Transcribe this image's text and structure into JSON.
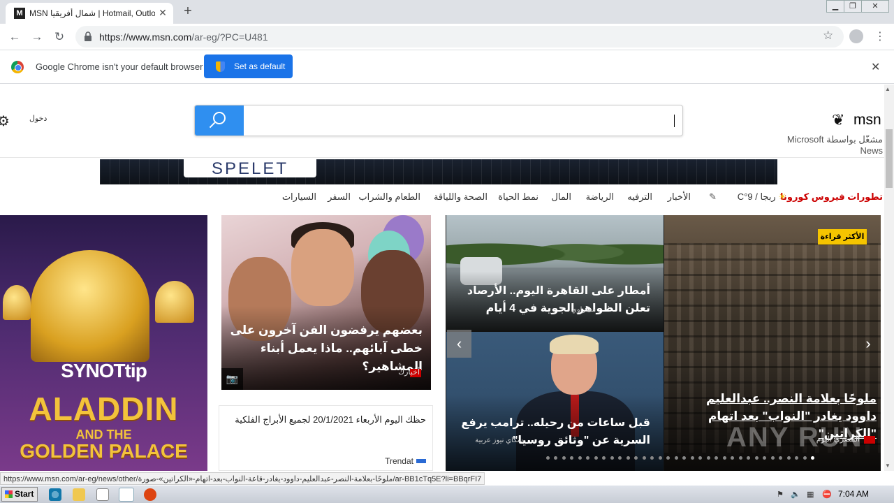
{
  "browser": {
    "tab_title": "MSN شمال أفريقيا | Hotmail, Outlook",
    "tab_favicon": "M",
    "url_host": "https://www.msn.com",
    "url_path": "/ar-eg/?PC=U481",
    "new_tab_glyph": "+",
    "close_glyph": "✕"
  },
  "infobar": {
    "message": "Google Chrome isn't your default browser",
    "button_label": "Set as default"
  },
  "msn": {
    "signin_label": "دخول",
    "logo_text": "msn",
    "subtitle": "مشغّل بواسطة Microsoft News",
    "banner_text": "SPELET"
  },
  "nav": {
    "corona": "تطورات فيروس كورونا",
    "weather": "ربجا / 9°C",
    "items": [
      "الأخبار",
      "الترفيه",
      "الرياضة",
      "المال",
      "نمط الحياة",
      "الصحة واللياقة",
      "الطعام والشراب",
      "السفر",
      "السيارات"
    ]
  },
  "ad": {
    "brand": "SYNOTtip",
    "line1": "ALADDIN",
    "line2": "AND THE",
    "line3": "GOLDEN PALACE"
  },
  "cards": {
    "celeb": {
      "title": "بعضهم يرفضون الفن آخرون على خطى آبائهم.. ماذا يعمل أبناء المشاهير؟",
      "source": "أخبارك"
    },
    "horoscope": {
      "title": "حظك اليوم الأربعاء 20/1/2021 لجميع الأبراج الفلكية",
      "source": "Trendat"
    }
  },
  "slider": {
    "hero": {
      "badge": "الأكثر قراءة",
      "title": "ملوحًا بعلامة النصر.. عبدالعليم داوود يغادر \"النواب\" بعد اتهام \"الكراتين\"",
      "source": "المصري اليوم"
    },
    "rain": {
      "title": "أمطار على القاهرة اليوم.. الأرصاد تعلن الظواهر الجوية في 4 أيام",
      "source": "مصراوي"
    },
    "trump": {
      "title": "قبل ساعات من رحيله.. ترامب يرفع السرية عن \"وثائق روسيا\"",
      "source": "سكاي نيوز عربية"
    },
    "total_dots": 34,
    "active_dot": 0
  },
  "status_url": "https://www.msn.com/ar-eg/news/other/ملوحًا-بعلامة-النصر-عبدالعليم-داوود-يغادر-قاعة-النواب-بعد-اتهام-«الكراتين»-صورة/ar-BB1cTq5E?li=BBqrFI7",
  "watermark": "ANY RUN",
  "taskbar": {
    "start_label": "Start",
    "clock": "7:04 AM"
  }
}
